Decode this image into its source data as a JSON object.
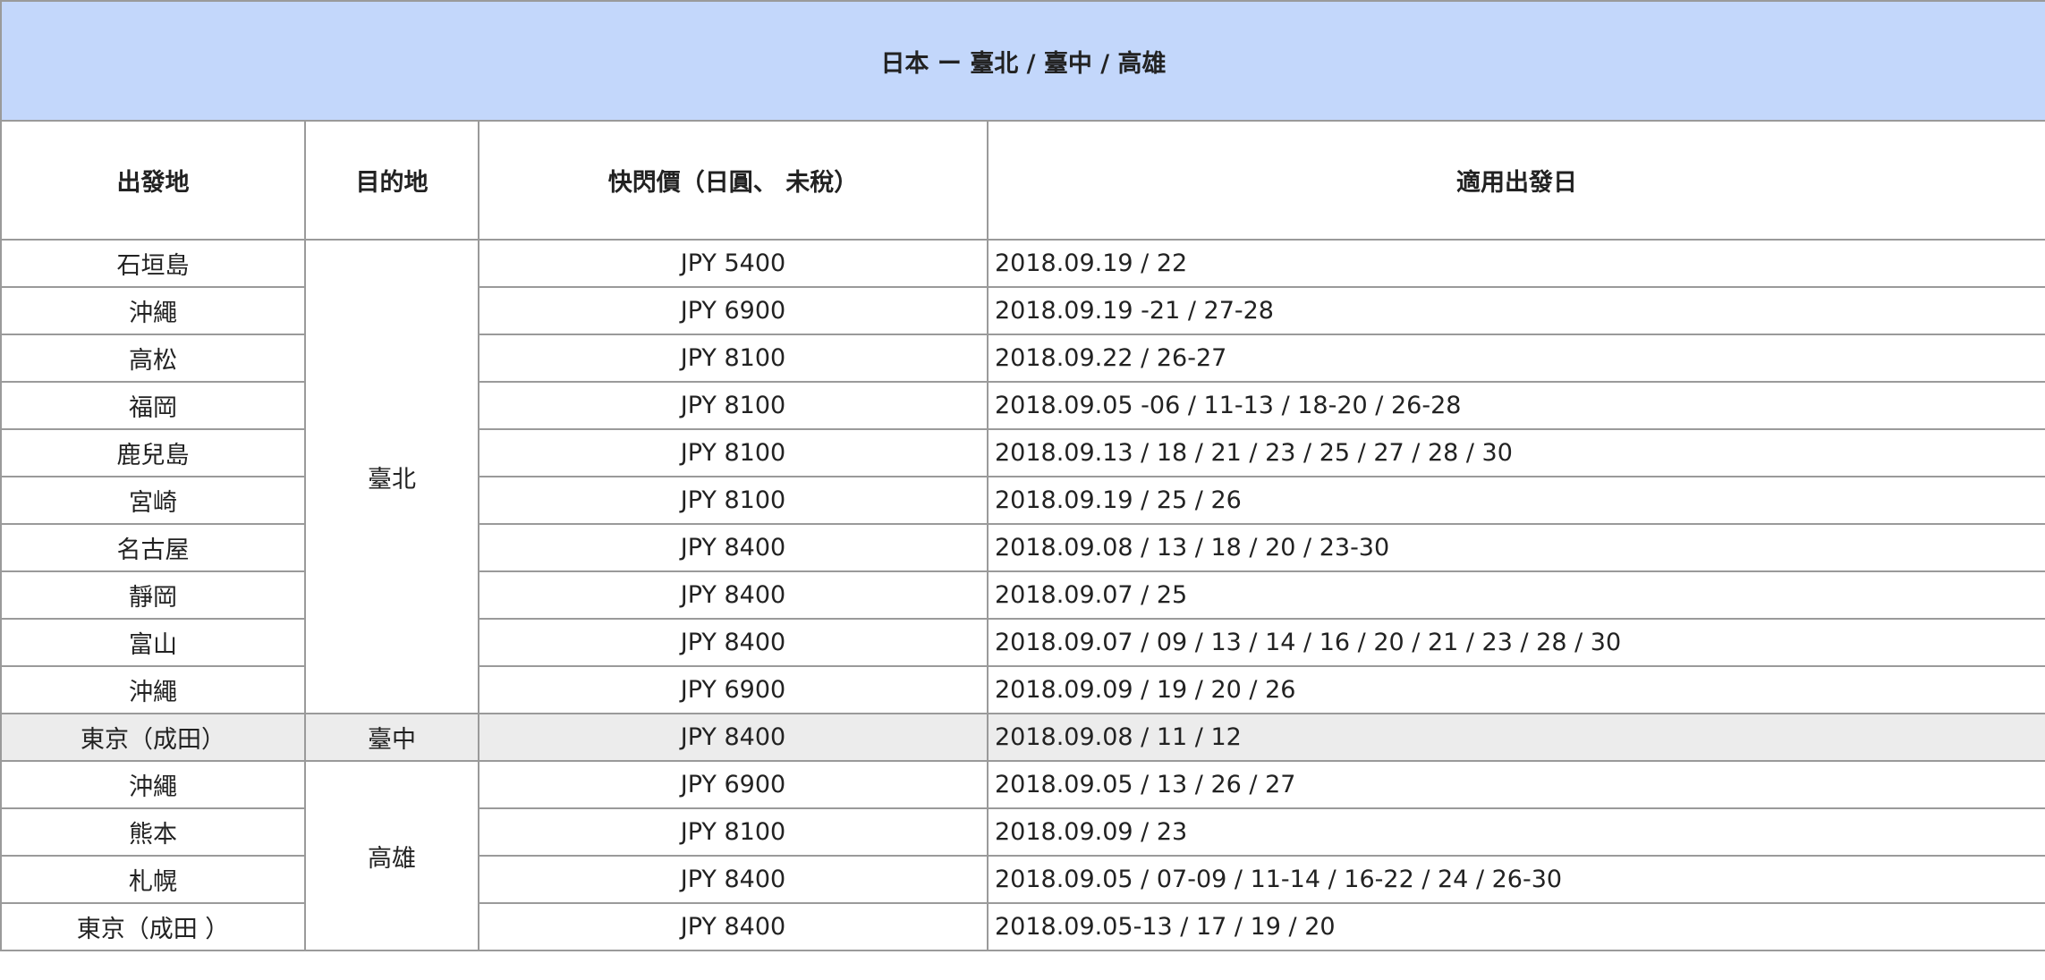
{
  "table": {
    "title": "日本 ー 臺北 / 臺中 / 高雄",
    "headers": {
      "origin": "出發地",
      "destination": "目的地",
      "price": "快閃價（日圓、 未稅）",
      "dates": "適用出發日"
    },
    "destinations": {
      "taipei": "臺北",
      "taichung": "臺中",
      "kaohsiung": "高雄"
    },
    "rows": [
      {
        "origin": "石垣島",
        "price": "JPY 5400",
        "dates": "2018.09.19 / 22"
      },
      {
        "origin": "沖繩",
        "price": "JPY 6900",
        "dates": "2018.09.19 -21 / 27-28"
      },
      {
        "origin": "高松",
        "price": "JPY 8100",
        "dates": "2018.09.22 / 26-27"
      },
      {
        "origin": "福岡",
        "price": "JPY 8100",
        "dates": "2018.09.05 -06 / 11-13 / 18-20 / 26-28"
      },
      {
        "origin": "鹿兒島",
        "price": "JPY 8100",
        "dates": "2018.09.13 / 18 / 21 / 23 / 25 / 27 / 28 / 30"
      },
      {
        "origin": "宮崎",
        "price": "JPY 8100",
        "dates": "2018.09.19 / 25 / 26"
      },
      {
        "origin": "名古屋",
        "price": "JPY 8400",
        "dates": "2018.09.08 / 13 / 18 / 20 / 23-30"
      },
      {
        "origin": "靜岡",
        "price": "JPY 8400",
        "dates": "2018.09.07 / 25"
      },
      {
        "origin": "富山",
        "price": "JPY 8400",
        "dates": "2018.09.07 / 09 / 13 / 14 / 16 / 20 / 21 / 23 / 28 / 30"
      },
      {
        "origin": "沖繩",
        "price": "JPY 6900",
        "dates": "2018.09.09 / 19 / 20 / 26"
      },
      {
        "origin": "東京（成田）",
        "price": "JPY 8400",
        "dates": "2018.09.08 / 11 / 12"
      },
      {
        "origin": "沖繩",
        "price": "JPY 6900",
        "dates": "2018.09.05 / 13 / 26 / 27"
      },
      {
        "origin": "熊本",
        "price": "JPY 8100",
        "dates": "2018.09.09 / 23"
      },
      {
        "origin": "札幌",
        "price": "JPY 8400",
        "dates": "2018.09.05 / 07-09 / 11-14 / 16-22 / 24 / 26-30"
      },
      {
        "origin": "東京（成田 ）",
        "price": "JPY 8400",
        "dates": "2018.09.05-13 / 17 / 19 / 20"
      }
    ]
  },
  "colors": {
    "title_background": "#c3d7fb",
    "header_text": "#2a5aa6",
    "highlight_row": "#ececec",
    "border": "#9a9a9a"
  }
}
